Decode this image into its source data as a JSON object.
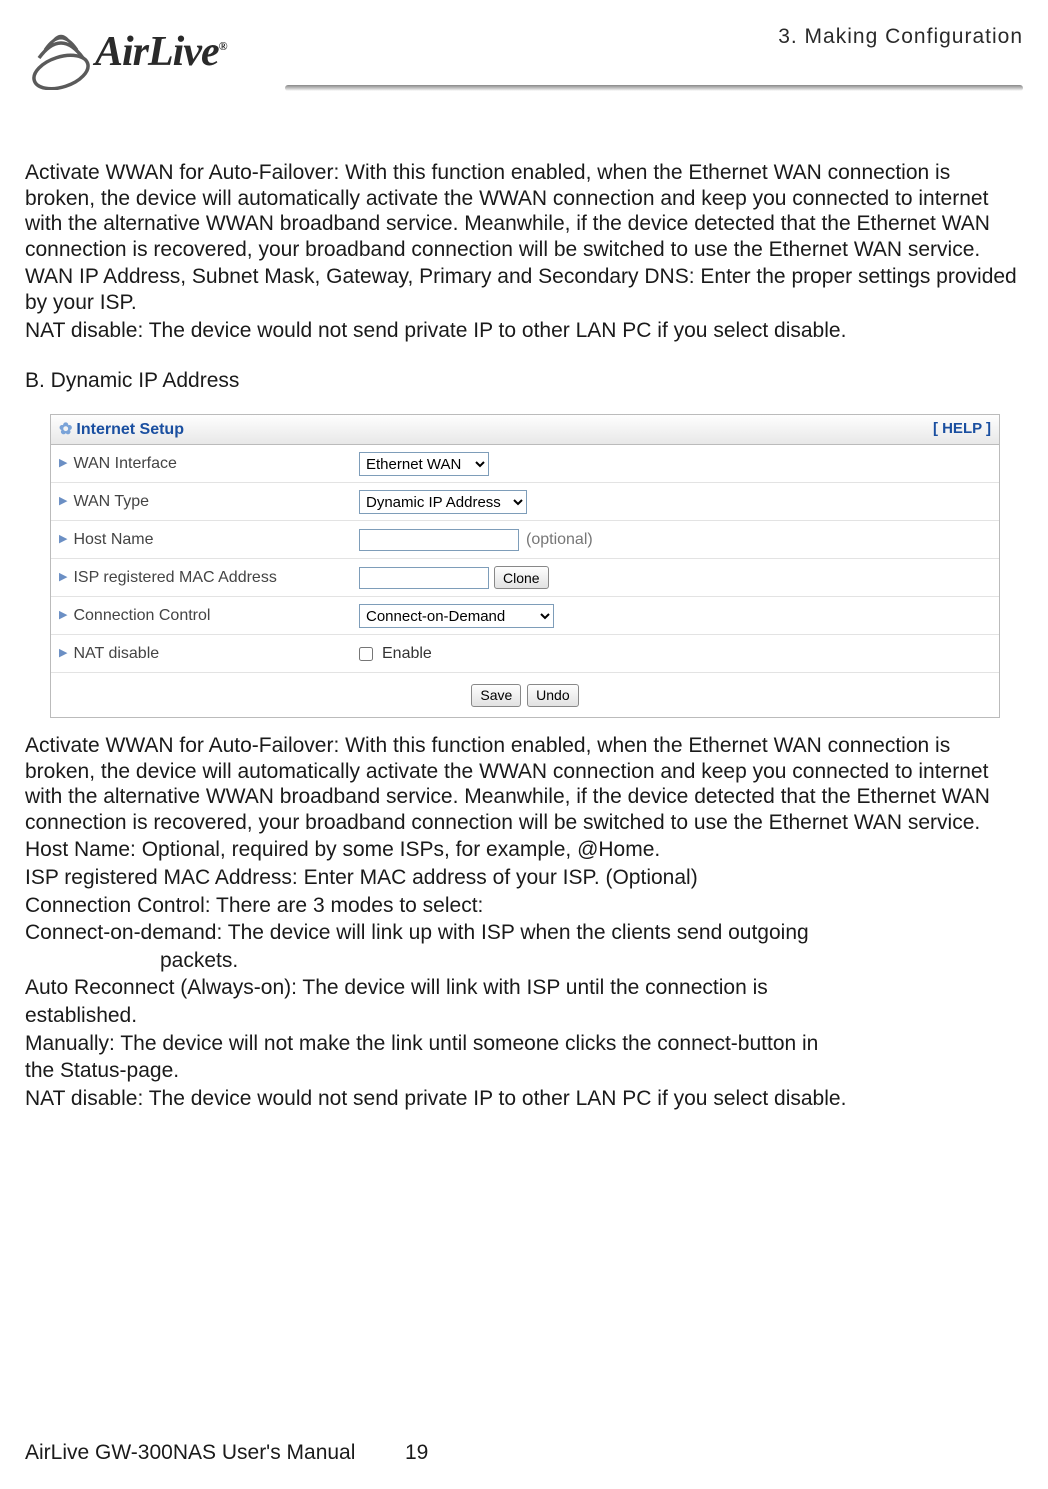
{
  "header": {
    "chapter": "3. Making Configuration",
    "logo_text": "AirLive"
  },
  "body": {
    "p1": "Activate WWAN for Auto-Failover: With this function enabled, when the Ethernet WAN connection is broken, the device will automatically activate the WWAN connection and keep you connected to internet with the alternative WWAN broadband service. Meanwhile, if the device detected that the Ethernet WAN connection is recovered, your broadband connection will be switched to use the Ethernet WAN service.",
    "p2": "WAN IP Address, Subnet Mask, Gateway, Primary and Secondary DNS: Enter the proper settings provided by your ISP.",
    "p3": "NAT disable: The device would not send private IP to other LAN PC if you select disable.",
    "heading_b": "B. Dynamic IP Address",
    "p4": "Activate WWAN for Auto-Failover: With this function enabled, when the Ethernet WAN connection is broken, the device will automatically activate the WWAN connection and keep you connected to internet with the alternative WWAN broadband service. Meanwhile, if the device detected that the Ethernet WAN connection is recovered, your broadband connection will be switched to use the Ethernet WAN service.",
    "p5": "Host Name: Optional, required by some ISPs, for example, @Home.",
    "p6": "ISP registered MAC Address: Enter MAC address of your ISP. (Optional)",
    "p7": "Connection Control: There are 3 modes to select:",
    "p8a": "Connect-on-demand: The device will link up with ISP when the clients send outgoing",
    "p8b": "packets.",
    "p9": "Auto Reconnect (Always-on): The device will link with ISP until the connection is",
    "p9b": "established.",
    "p10": "Manually: The device will not make the link until someone clicks the connect-button in",
    "p10b": "the Status-page.",
    "p11": "NAT disable: The device would not send private IP to other LAN PC if you select disable."
  },
  "panel": {
    "title": "Internet Setup",
    "help": "[ HELP ]",
    "rows": {
      "wan_interface": {
        "label": "WAN Interface",
        "value": "Ethernet WAN"
      },
      "wan_type": {
        "label": "WAN Type",
        "value": "Dynamic IP Address"
      },
      "host_name": {
        "label": "Host Name",
        "value": "",
        "optional": "(optional)"
      },
      "isp_mac": {
        "label": "ISP registered MAC Address",
        "value": "",
        "button": "Clone"
      },
      "conn_control": {
        "label": "Connection Control",
        "value": "Connect-on-Demand"
      },
      "nat_disable": {
        "label": "NAT disable",
        "enable_label": "Enable"
      }
    },
    "buttons": {
      "save": "Save",
      "undo": "Undo"
    }
  },
  "footer": {
    "title": "AirLive GW-300NAS User's Manual",
    "page": "19"
  }
}
